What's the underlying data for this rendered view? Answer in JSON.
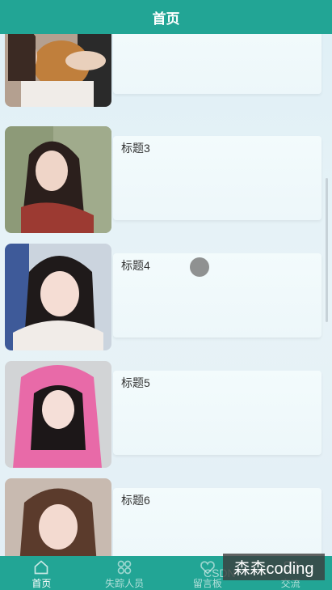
{
  "header": {
    "title": "首页"
  },
  "list": {
    "items": [
      {
        "title": ""
      },
      {
        "title": "标题3"
      },
      {
        "title": "标题4"
      },
      {
        "title": "标题5"
      },
      {
        "title": "标题6"
      }
    ]
  },
  "tabs": [
    {
      "label": "首页",
      "icon": "home-icon",
      "active": true
    },
    {
      "label": "失踪人员",
      "icon": "people-icon"
    },
    {
      "label": "留言板",
      "icon": "heart-icon"
    },
    {
      "label": "交流",
      "icon": "chat-icon"
    }
  ],
  "watermark": {
    "text": "森森coding",
    "csdn": "CSDN"
  },
  "colors": {
    "primary": "#22a595"
  }
}
